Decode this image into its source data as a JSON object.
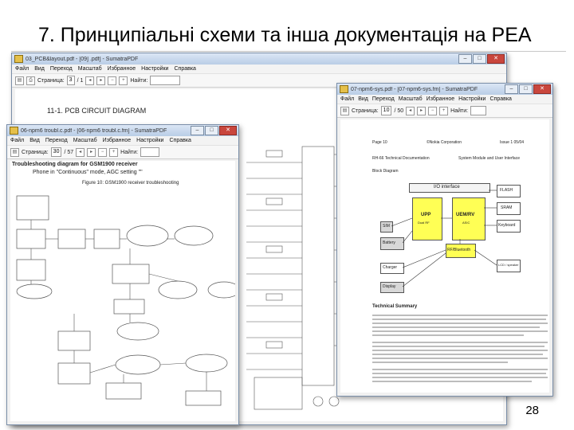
{
  "slide": {
    "title": "7. Принципіальні схеми та інша документація на РЕА",
    "page_number": "28"
  },
  "windows": {
    "back": {
      "title": "03_PCB&layout.pdf - [09] .pdf] - SumatraPDF",
      "menu": [
        "Файл",
        "Вид",
        "Переход",
        "Масштаб",
        "Избранное",
        "Настройки",
        "Справка"
      ],
      "page_label": "Страница:",
      "page_value": "3",
      "page_total": "/ 1",
      "find_label": "Найти:",
      "heading": "11-1. PCB  CIRCUIT  DIAGRAM"
    },
    "left": {
      "title": "06-npm6 troubl.c.pdf - [06-npm6 troubl.c.fm] - SumatraPDF",
      "menu": [
        "Файл",
        "Вид",
        "Переход",
        "Масштаб",
        "Избранное",
        "Настройки",
        "Справка"
      ],
      "page_label": "Страница:",
      "page_value": "30",
      "page_total": "/ 57",
      "find_label": "Найти:",
      "doc_line1": "Troubleshooting diagram for GSM1900 receiver",
      "doc_line2": "Phone in \"Continuous\" mode, AGC setting \"\"",
      "doc_caption": "Figure 10: GSM1900 receiver troubleshooting"
    },
    "right": {
      "title": "07-npm6-sys.pdf - [07-npm6-sys.fm] - SumatraPDF",
      "menu": [
        "Файл",
        "Вид",
        "Переход",
        "Масштаб",
        "Избранное",
        "Настройки",
        "Справка"
      ],
      "page_label": "Страница:",
      "page_value": "10",
      "page_total": "/ 50",
      "find_label": "Найти:",
      "header_left": "Page 10",
      "header_mid": "©Nokia Corporation",
      "header_right": "Issue 1 05/04",
      "header2_left": "RH-66 Technical Documentation",
      "header2_right": "System Module and User Interface",
      "block_label": "Block Diagram",
      "block_io": "I/O interface",
      "block_flash": "FLASH",
      "block_sram": "SRAM",
      "block_upp": "UPP",
      "block_upp_sub": "Dual RF",
      "block_uem": "UEM/RV",
      "block_uem_sub": "ASIC",
      "block_keypad": "Keyboard",
      "block_battery": "Battery",
      "block_rf": "RF/Bluetooth",
      "block_charger": "Charger",
      "block_lcd": "LCD / speaker",
      "block_sim": "SIM",
      "block_display": "Display",
      "summary_title": "Technical Summary"
    }
  }
}
